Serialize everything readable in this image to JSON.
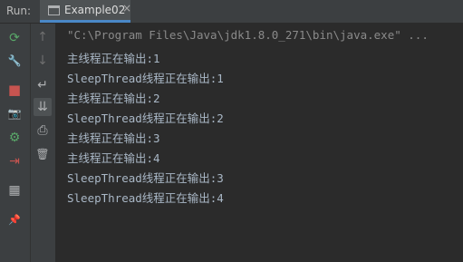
{
  "toolwindow": {
    "label": "Run:"
  },
  "tab": {
    "title": "Example02",
    "close": "×"
  },
  "left_toolbar": {
    "rerun": "⟳",
    "wrench": "🔧",
    "stop": "■",
    "camera": "📷",
    "debug": "⚙",
    "exit": "⇥",
    "layout": "▦",
    "pin": "📌"
  },
  "secondary_toolbar": {
    "up": "↑",
    "down": "↓",
    "wrap": "↵",
    "scroll_end": "⇊",
    "print": "⎙",
    "trash": "🗑"
  },
  "console": {
    "command": "\"C:\\Program Files\\Java\\jdk1.8.0_271\\bin\\java.exe\" ...",
    "lines": [
      "主线程正在输出:1",
      "SleepThread线程正在输出:1",
      "主线程正在输出:2",
      "SleepThread线程正在输出:2",
      "主线程正在输出:3",
      "主线程正在输出:4",
      "SleepThread线程正在输出:3",
      "SleepThread线程正在输出:4"
    ]
  }
}
